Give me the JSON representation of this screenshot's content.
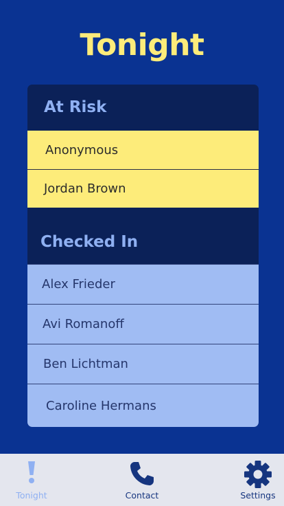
{
  "header": {
    "title": "Tonight"
  },
  "at_risk": {
    "title": "At Risk",
    "items": [
      {
        "name": "Anonymous"
      },
      {
        "name": "Jordan Brown"
      }
    ]
  },
  "checked_in": {
    "title": "Checked In",
    "items": [
      {
        "name": "Alex Frieder"
      },
      {
        "name": "Avi Romanoff"
      },
      {
        "name": "Ben Lichtman"
      },
      {
        "name": "Caroline Hermans"
      }
    ]
  },
  "tabs": [
    {
      "label": "Tonight",
      "icon": "exclamation-icon",
      "active": true
    },
    {
      "label": "Contact",
      "icon": "phone-icon",
      "active": false
    },
    {
      "label": "Settings",
      "icon": "gear-icon",
      "active": false
    }
  ],
  "colors": {
    "background": "#0a3392",
    "card": "#0b2158",
    "title": "#fdec7a",
    "at_risk_row": "#fdec7a",
    "checked_in_row": "#a0bcf3",
    "section_header": "#8fb0f2",
    "tabbar": "#e4e6ee",
    "tab_active": "#8fb0f2",
    "tab_inactive": "#16357f"
  }
}
